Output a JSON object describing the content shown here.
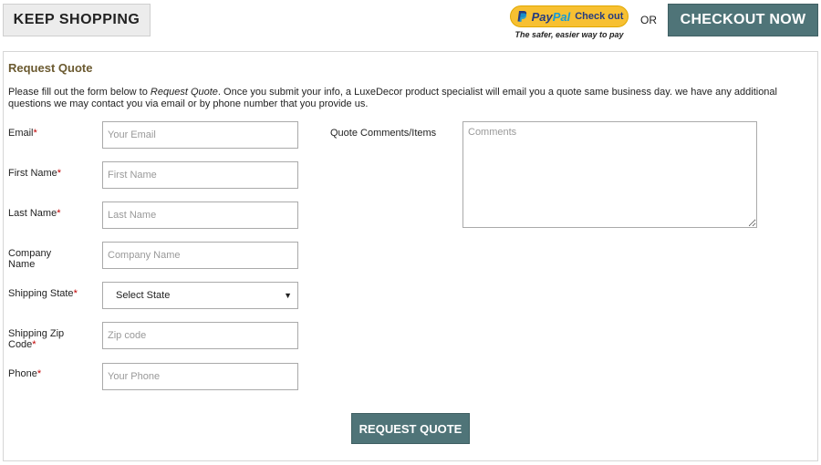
{
  "header": {
    "keep_shopping_label": "KEEP SHOPPING",
    "paypal": {
      "word1": "Pay",
      "word2": "Pal",
      "checkout_label": "Check out",
      "tagline": "The safer, easier way to pay"
    },
    "or_label": "OR",
    "checkout_now_label": "CHECKOUT NOW"
  },
  "form": {
    "title": "Request Quote",
    "intro_before": "Please fill out the form below to ",
    "intro_emphasis": "Request Quote",
    "intro_after": ". Once you submit your info, a LuxeDecor product specialist will email you a quote same business day. we have any additional questions we may contact you via email or by phone number that you provide us.",
    "required_marker": "*",
    "fields": {
      "email": {
        "label": "Email",
        "placeholder": "Your Email",
        "value": ""
      },
      "first_name": {
        "label": "First Name",
        "placeholder": "First Name",
        "value": ""
      },
      "last_name": {
        "label": "Last Name",
        "placeholder": "Last Name",
        "value": ""
      },
      "company": {
        "label": "Company Name",
        "placeholder": "Company Name",
        "value": ""
      },
      "state": {
        "label": "Shipping State",
        "selected": "Select State"
      },
      "zip": {
        "label_line1": "Shipping Zip",
        "label_line2": "Code",
        "placeholder": "Zip code",
        "value": ""
      },
      "phone": {
        "label": "Phone",
        "placeholder": "Your Phone",
        "value": ""
      }
    },
    "comments": {
      "label": "Quote Comments/Items",
      "placeholder": "Comments"
    },
    "submit_label": "REQUEST QUOTE"
  },
  "colors": {
    "accent_button": "#4f7478",
    "title_color": "#6b5a30",
    "required": "#c00000",
    "paypal_yellow": "#f7c032"
  }
}
